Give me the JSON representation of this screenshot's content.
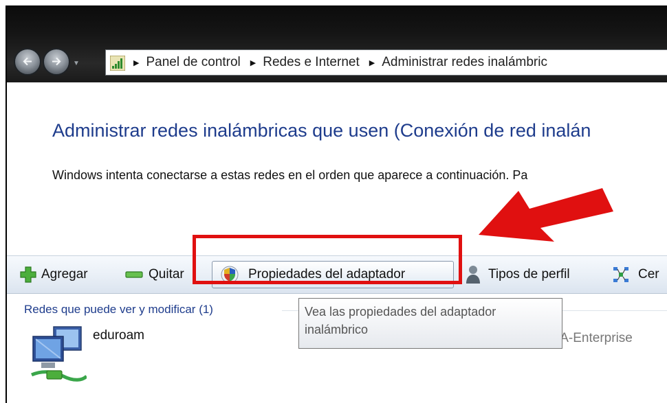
{
  "window": {
    "breadcrumbs": [
      "Panel de control",
      "Redes e Internet",
      "Administrar redes inalámbric"
    ]
  },
  "page": {
    "title": "Administrar redes inalámbricas que usen (Conexión de red inalán",
    "description": "Windows intenta conectarse a estas redes en el orden que aparece a continuación. Pa"
  },
  "toolbar": {
    "add_label": "Agregar",
    "remove_label": "Quitar",
    "adapter_label": "Propiedades del adaptador",
    "profile_types_label": "Tipos de perfil",
    "partial_label": "Cer"
  },
  "list": {
    "group_header": "Redes que puede ver y modificar (1)",
    "networks": [
      {
        "name": "eduroam",
        "security": "PA-Enterprise"
      }
    ]
  },
  "tooltip": {
    "line1": "Vea las propiedades del adaptador",
    "line2": "inalámbrico"
  },
  "colors": {
    "highlight": "#e01010",
    "link_blue": "#1e3c8c"
  },
  "icons": [
    "back-arrow-icon",
    "forward-arrow-icon",
    "signal-bars-icon",
    "plus-icon",
    "minus-icon",
    "shield-icon",
    "person-icon",
    "network-center-icon",
    "network-computers-icon"
  ]
}
